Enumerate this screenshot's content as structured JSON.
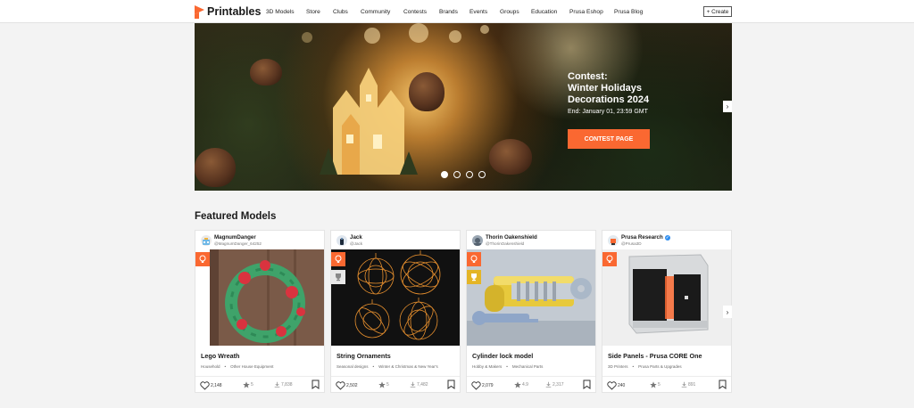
{
  "brand": {
    "name": "Printables",
    "accent": "#fa6831"
  },
  "nav": {
    "items": [
      "3D Models",
      "Store",
      "Clubs",
      "Community",
      "Contests",
      "Brands",
      "Events",
      "Groups",
      "Education",
      "Prusa Eshop",
      "Prusa Blog"
    ],
    "create_label": "+ Create"
  },
  "hero": {
    "heading_line1": "Contest:",
    "heading_line2": "Winter Holidays",
    "heading_line3": "Decorations 2024",
    "end_text": "End: January 01, 23:59 GMT",
    "button_label": "CONTEST PAGE",
    "slide_count": 4,
    "active_slide": 1
  },
  "featured": {
    "title": "Featured Models",
    "cards": [
      {
        "user": "MagnumDanger",
        "handle": "@MagnumDanger_64252",
        "title": "Lego Wreath",
        "cat1": "Household",
        "cat2": "Other House Equipment",
        "likes": "2,148",
        "rating": "5",
        "downloads": "7,838",
        "verified": false,
        "trophy": false
      },
      {
        "user": "Jack",
        "handle": "@Jack",
        "title": "String Ornaments",
        "cat1": "Seasonal designs",
        "cat2": "Winter & Christmas & New Year's",
        "likes": "2,502",
        "rating": "5",
        "downloads": "7,482",
        "verified": false,
        "trophy": true
      },
      {
        "user": "Thorin Oakenshield",
        "handle": "@ThorinOakenshield",
        "title": "Cylinder lock model",
        "cat1": "Hobby & Makers",
        "cat2": "Mechanical Parts",
        "likes": "2,079",
        "rating": "4.9",
        "downloads": "2,317",
        "verified": false,
        "trophy": true
      },
      {
        "user": "Prusa Research",
        "handle": "@Prusa3D",
        "title": "Side Panels - Prusa CORE One",
        "cat1": "3D Printers",
        "cat2": "Prusa Parts & Upgrades",
        "likes": "240",
        "rating": "5",
        "downloads": "891",
        "verified": true,
        "trophy": false
      }
    ]
  }
}
